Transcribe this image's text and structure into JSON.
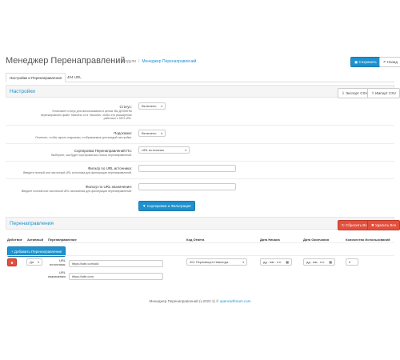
{
  "header": {
    "title": "Менеджер Перенаправлений",
    "breadcrumb": {
      "modules": "Модули",
      "current": "Менеджер Перенаправлений"
    },
    "save_label": "Сохранить",
    "back_label": "Назад"
  },
  "tabs": [
    {
      "label": "Настройки и Перенаправления"
    },
    {
      "label": "404 URL"
    }
  ],
  "settings": {
    "panel_title": "Настройки",
    "export_label": "Экспорт CSV",
    "import_label": "Импорт CSV",
    "fields": [
      {
        "label": "Статус:",
        "help": "Установите статус для использования в целом. Вы ДОЛЖНЫ перенаправлять файл .htaccess от в .htaccess, чтобы это расширение работало с SEO URL.",
        "value": "Включено"
      },
      {
        "label": "Подсказки:",
        "help": "Отметьте, чтобы скрыть подсказки, отображаемые для каждой настройки.",
        "value": "Включено"
      },
      {
        "label": "Сортировка Перенаправлений По:",
        "help": "Выберите, как будет сортироваться список перенаправлений.",
        "value": "URL источника"
      },
      {
        "label": "Фильтр по URL источника:",
        "help": "Введите полный или частичный URL источника для фильтрации перенаправлений.",
        "value": ""
      },
      {
        "label": "Фильтр по URL назначения:",
        "help": "Введите полный или частичный URL назначения для фильтрации перенаправлений.",
        "value": ""
      }
    ],
    "sort_filter_label": "Сортировка и Фильтрация"
  },
  "redirects": {
    "panel_title": "Перенаправления",
    "reset_all_label": "Сбросить Все",
    "delete_all_label": "Удалить Все",
    "columns": [
      "Действие",
      "Активный",
      "Перенаправление",
      "Код Ответа",
      "Дата Начала",
      "Дата Окончания",
      "Количество Использований"
    ],
    "add_label": "Добавить Перенаправление",
    "row": {
      "active": "Да",
      "source_label": "URL источника:",
      "source_value": "https://site.com/old",
      "target_label": "URL назначения:",
      "target_value": "https://site.com",
      "response_code": "301 Перемещен Навсегда",
      "start_date": "дд . мм . гггг",
      "end_date": "дд . мм . гггг",
      "uses": "0"
    }
  },
  "footer": {
    "text": "Менеджер Перенаправлений (v.2022.1) © ",
    "link": "opencartforum.com"
  }
}
